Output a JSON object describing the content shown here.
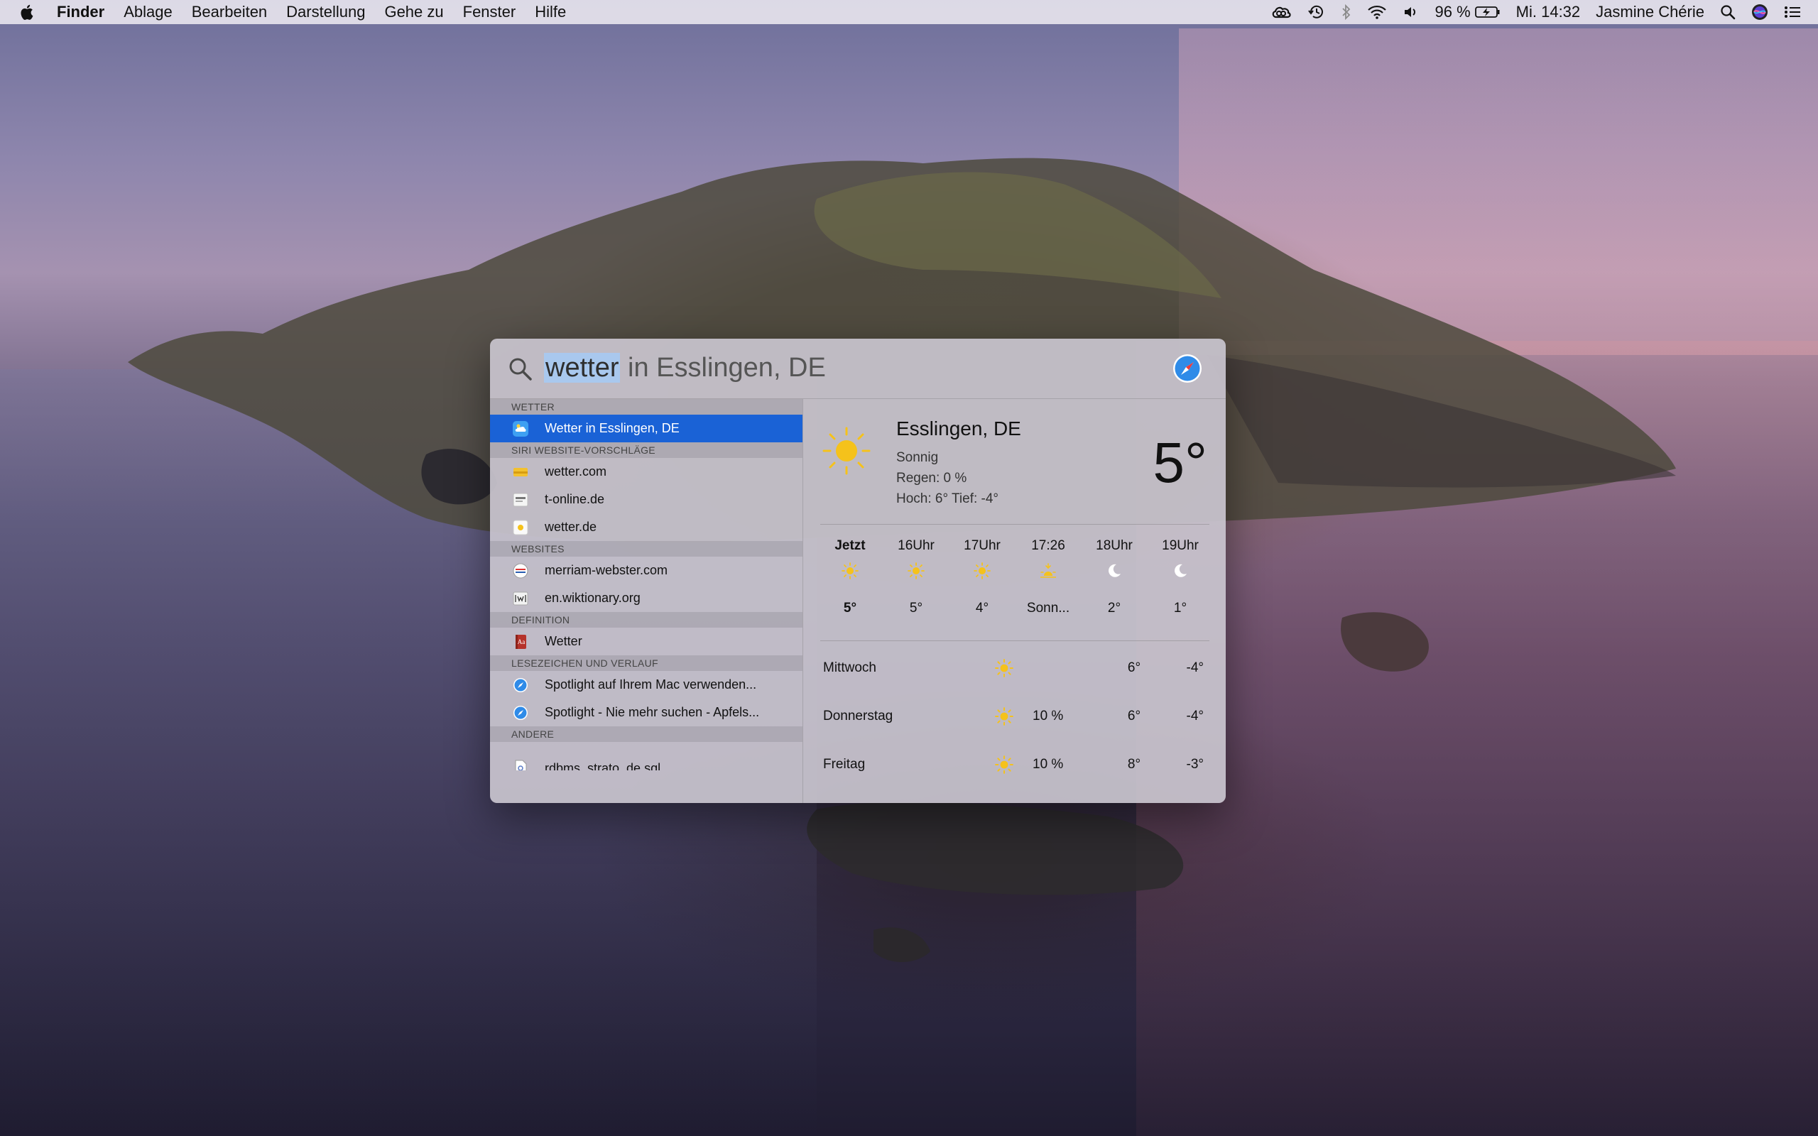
{
  "menubar": {
    "app_name": "Finder",
    "menus": [
      "Ablage",
      "Bearbeiten",
      "Darstellung",
      "Gehe zu",
      "Fenster",
      "Hilfe"
    ],
    "battery": "96 %",
    "clock": "Mi. 14:32",
    "user": "Jasmine Chérie"
  },
  "spotlight": {
    "query_selected": "wetter",
    "query_rest": " in Esslingen, DE",
    "sections": {
      "weather": "WETTER",
      "siri": "SIRI WEBSITE-VORSCHLÄGE",
      "websites": "WEBSITES",
      "definition": "DEFINITION",
      "bookmarks": "LESEZEICHEN UND VERLAUF",
      "other": "ANDERE"
    },
    "results": {
      "weather_top": "Wetter in Esslingen, DE",
      "siri_sites": [
        "wetter.com",
        "t-online.de",
        "wetter.de"
      ],
      "websites": [
        "merriam-webster.com",
        "en.wiktionary.org"
      ],
      "definition": "Wetter",
      "bookmarks": [
        "Spotlight auf Ihrem Mac verwenden...",
        "Spotlight - Nie mehr suchen - Apfels..."
      ],
      "other": "rdbms_strato_de.sql"
    },
    "weather": {
      "city": "Esslingen, DE",
      "condition": "Sonnig",
      "rain": "Regen: 0 %",
      "hilo": "Hoch: 6° Tief: -4°",
      "temp": "5°",
      "hourly": [
        {
          "label": "Jetzt",
          "icon": "sun-icon",
          "temp": "5°"
        },
        {
          "label": "16Uhr",
          "icon": "sun-icon",
          "temp": "5°"
        },
        {
          "label": "17Uhr",
          "icon": "sun-icon",
          "temp": "4°"
        },
        {
          "label": "17:26",
          "icon": "sunset-icon",
          "temp": "Sonn..."
        },
        {
          "label": "18Uhr",
          "icon": "moon-icon",
          "temp": "2°"
        },
        {
          "label": "19Uhr",
          "icon": "moon-icon",
          "temp": "1°"
        }
      ],
      "daily": [
        {
          "day": "Mittwoch",
          "precip": "",
          "high": "6°",
          "low": "-4°"
        },
        {
          "day": "Donnerstag",
          "precip": "10 %",
          "high": "6°",
          "low": "-4°"
        },
        {
          "day": "Freitag",
          "precip": "10 %",
          "high": "8°",
          "low": "-3°"
        }
      ]
    },
    "colors": {
      "selection": "#1a62d6",
      "sun": "#f5c21b"
    }
  }
}
